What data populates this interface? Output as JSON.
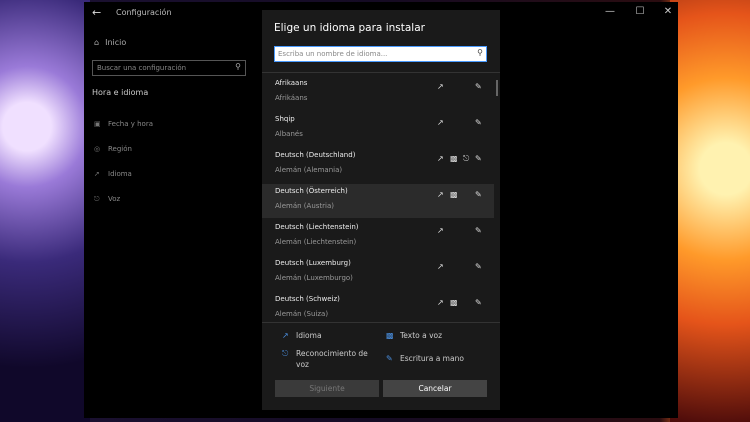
{
  "settings": {
    "title": "Configuración",
    "home": "Inicio",
    "search_placeholder": "Buscar una configuración",
    "section": "Hora e idioma",
    "nav_items": [
      {
        "label": "Fecha y hora",
        "icon": "calendar-clock-icon"
      },
      {
        "label": "Región",
        "icon": "globe-icon"
      },
      {
        "label": "Idioma",
        "icon": "language-icon"
      },
      {
        "label": "Voz",
        "icon": "microphone-icon"
      }
    ]
  },
  "dialog": {
    "title": "Elige un idioma para instalar",
    "search_placeholder": "Escriba un nombre de idioma...",
    "languages": [
      {
        "name": "Afrikaans",
        "native": "Afrikáans",
        "features": [
          "language-pack",
          "handwriting"
        ]
      },
      {
        "name": "Shqip",
        "native": "Albanés",
        "features": [
          "language-pack",
          "handwriting"
        ]
      },
      {
        "name": "Deutsch (Deutschland)",
        "native": "Alemán (Alemania)",
        "features": [
          "language-pack",
          "text-to-speech",
          "speech",
          "handwriting"
        ]
      },
      {
        "name": "Deutsch (Österreich)",
        "native": "Alemán (Austria)",
        "features": [
          "language-pack",
          "text-to-speech",
          "handwriting"
        ],
        "selected": true
      },
      {
        "name": "Deutsch (Liechtenstein)",
        "native": "Alemán (Liechtenstein)",
        "features": [
          "language-pack",
          "handwriting"
        ]
      },
      {
        "name": "Deutsch (Luxemburg)",
        "native": "Alemán (Luxemburgo)",
        "features": [
          "language-pack",
          "handwriting"
        ]
      },
      {
        "name": "Deutsch (Schweiz)",
        "native": "Alemán (Suiza)",
        "features": [
          "language-pack",
          "text-to-speech",
          "handwriting"
        ]
      }
    ],
    "legend": {
      "language": "Idioma",
      "tts": "Texto a voz",
      "speech": "Reconocimiento de voz",
      "handwriting": "Escritura a mano"
    },
    "next_label": "Siguiente",
    "cancel_label": "Cancelar"
  },
  "colors": {
    "accent": "#4a8fe0",
    "dialog_bg": "#1a1a1a",
    "selected_bg": "#2b2b2b"
  }
}
